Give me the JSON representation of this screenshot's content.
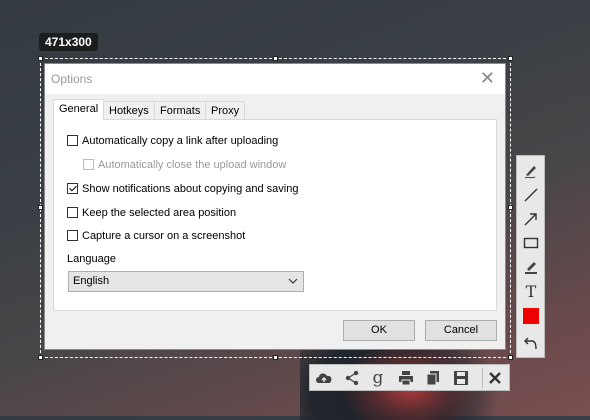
{
  "selection": {
    "size_label": "471x300"
  },
  "dialog": {
    "title": "Options",
    "tabs": [
      {
        "label": "General",
        "active": true
      },
      {
        "label": "Hotkeys",
        "active": false
      },
      {
        "label": "Formats",
        "active": false
      },
      {
        "label": "Proxy",
        "active": false
      }
    ],
    "general": {
      "options": [
        {
          "label": "Automatically copy a link after uploading",
          "checked": false,
          "disabled": false
        },
        {
          "label": "Automatically close the upload window",
          "checked": false,
          "disabled": true
        },
        {
          "label": "Show notifications about copying and saving",
          "checked": true,
          "disabled": false
        },
        {
          "label": "Keep the selected area position",
          "checked": false,
          "disabled": false
        },
        {
          "label": "Capture a cursor on a screenshot",
          "checked": false,
          "disabled": false
        }
      ],
      "language_label": "Language",
      "language_value": "English"
    },
    "ok_label": "OK",
    "cancel_label": "Cancel"
  },
  "side_toolbar": {
    "tools": [
      "pen-icon",
      "line-icon",
      "arrow-icon",
      "rectangle-icon",
      "marker-icon",
      "text-icon",
      "color-swatch",
      "undo-icon"
    ],
    "text_tool_glyph": "T",
    "color": "#ee0000"
  },
  "bottom_toolbar": {
    "tools": [
      "upload-cloud-icon",
      "share-icon",
      "google-search-icon",
      "print-icon",
      "copy-icon",
      "save-icon",
      "close-icon"
    ],
    "google_glyph": "g"
  }
}
